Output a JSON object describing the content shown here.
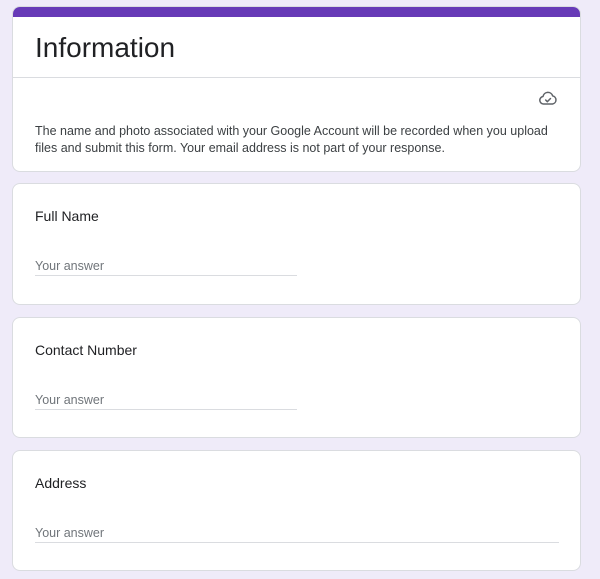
{
  "form": {
    "title": "Information",
    "cloud_icon": "cloud-check-icon",
    "notice": "The name and photo associated with your Google Account will be recorded when you upload files and submit this form. Your email address is not part of your response.",
    "accent_color": "#673ab7",
    "background_color": "#efebf9"
  },
  "questions": [
    {
      "label": "Full Name",
      "placeholder": "Your answer",
      "value": ""
    },
    {
      "label": "Contact Number",
      "placeholder": "Your answer",
      "value": ""
    },
    {
      "label": "Address",
      "placeholder": "Your answer",
      "value": ""
    }
  ]
}
